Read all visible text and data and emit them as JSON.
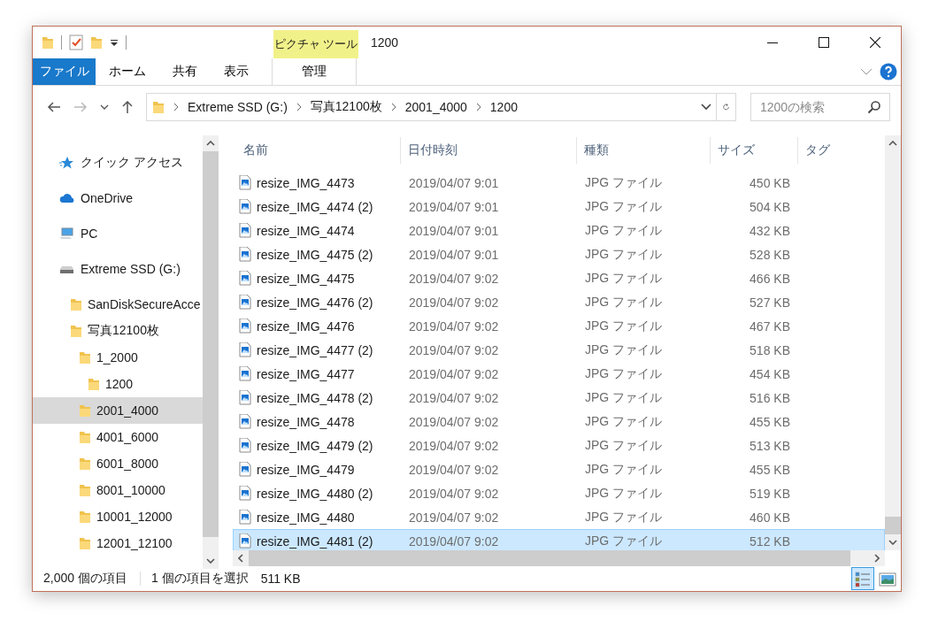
{
  "window": {
    "title": "1200"
  },
  "ribbon": {
    "context_group": "ピクチャ ツール",
    "tabs": [
      {
        "label": "ファイル",
        "kind": "file"
      },
      {
        "label": "ホーム",
        "kind": "normal"
      },
      {
        "label": "共有",
        "kind": "normal"
      },
      {
        "label": "表示",
        "kind": "normal"
      },
      {
        "label": "管理",
        "kind": "contextual"
      }
    ]
  },
  "address": {
    "crumbs": [
      "Extreme SSD (G:)",
      "写真12100枚",
      "2001_4000",
      "1200"
    ]
  },
  "search": {
    "placeholder": "1200の検索"
  },
  "nav": {
    "items": [
      {
        "label": "クイック アクセス",
        "kind": "quick",
        "selected": false
      },
      {
        "label": "OneDrive",
        "kind": "cloud",
        "selected": false
      },
      {
        "label": "PC",
        "kind": "pc",
        "selected": false
      },
      {
        "label": "Extreme SSD (G:)",
        "kind": "drive",
        "selected": false,
        "children": [
          {
            "label": "SanDiskSecureAcce",
            "kind": "folder",
            "selected": false
          },
          {
            "label": "写真12100枚",
            "kind": "folder",
            "selected": false,
            "children": [
              {
                "label": "1_2000",
                "kind": "folder",
                "selected": false,
                "children": [
                  {
                    "label": "1200",
                    "kind": "folder",
                    "selected": false
                  }
                ]
              },
              {
                "label": "2001_4000",
                "kind": "folder",
                "selected": true
              },
              {
                "label": "4001_6000",
                "kind": "folder",
                "selected": false
              },
              {
                "label": "6001_8000",
                "kind": "folder",
                "selected": false
              },
              {
                "label": "8001_10000",
                "kind": "folder",
                "selected": false
              },
              {
                "label": "10001_12000",
                "kind": "folder",
                "selected": false
              },
              {
                "label": "12001_12100",
                "kind": "folder",
                "selected": false
              }
            ]
          }
        ]
      }
    ]
  },
  "files": {
    "columns": [
      "名前",
      "日付時刻",
      "種類",
      "サイズ",
      "タグ"
    ],
    "rows": [
      {
        "name": "resize_IMG_4473",
        "date": "2019/04/07 9:01",
        "type": "JPG ファイル",
        "size": "450 KB",
        "selected": false
      },
      {
        "name": "resize_IMG_4474 (2)",
        "date": "2019/04/07 9:01",
        "type": "JPG ファイル",
        "size": "504 KB",
        "selected": false
      },
      {
        "name": "resize_IMG_4474",
        "date": "2019/04/07 9:01",
        "type": "JPG ファイル",
        "size": "432 KB",
        "selected": false
      },
      {
        "name": "resize_IMG_4475 (2)",
        "date": "2019/04/07 9:01",
        "type": "JPG ファイル",
        "size": "528 KB",
        "selected": false
      },
      {
        "name": "resize_IMG_4475",
        "date": "2019/04/07 9:02",
        "type": "JPG ファイル",
        "size": "466 KB",
        "selected": false
      },
      {
        "name": "resize_IMG_4476 (2)",
        "date": "2019/04/07 9:02",
        "type": "JPG ファイル",
        "size": "527 KB",
        "selected": false
      },
      {
        "name": "resize_IMG_4476",
        "date": "2019/04/07 9:02",
        "type": "JPG ファイル",
        "size": "467 KB",
        "selected": false
      },
      {
        "name": "resize_IMG_4477 (2)",
        "date": "2019/04/07 9:02",
        "type": "JPG ファイル",
        "size": "518 KB",
        "selected": false
      },
      {
        "name": "resize_IMG_4477",
        "date": "2019/04/07 9:02",
        "type": "JPG ファイル",
        "size": "454 KB",
        "selected": false
      },
      {
        "name": "resize_IMG_4478 (2)",
        "date": "2019/04/07 9:02",
        "type": "JPG ファイル",
        "size": "516 KB",
        "selected": false
      },
      {
        "name": "resize_IMG_4478",
        "date": "2019/04/07 9:02",
        "type": "JPG ファイル",
        "size": "455 KB",
        "selected": false
      },
      {
        "name": "resize_IMG_4479 (2)",
        "date": "2019/04/07 9:02",
        "type": "JPG ファイル",
        "size": "513 KB",
        "selected": false
      },
      {
        "name": "resize_IMG_4479",
        "date": "2019/04/07 9:02",
        "type": "JPG ファイル",
        "size": "455 KB",
        "selected": false
      },
      {
        "name": "resize_IMG_4480 (2)",
        "date": "2019/04/07 9:02",
        "type": "JPG ファイル",
        "size": "519 KB",
        "selected": false
      },
      {
        "name": "resize_IMG_4480",
        "date": "2019/04/07 9:02",
        "type": "JPG ファイル",
        "size": "460 KB",
        "selected": false
      },
      {
        "name": "resize_IMG_4481 (2)",
        "date": "2019/04/07 9:02",
        "type": "JPG ファイル",
        "size": "512 KB",
        "selected": true
      }
    ]
  },
  "status_bar": {
    "item_count": "2,000 個の項目",
    "selection": "1 個の項目を選択",
    "selection_size": "511 KB",
    "views": [
      {
        "kind": "details",
        "selected": true
      },
      {
        "kind": "large",
        "selected": false
      }
    ]
  }
}
